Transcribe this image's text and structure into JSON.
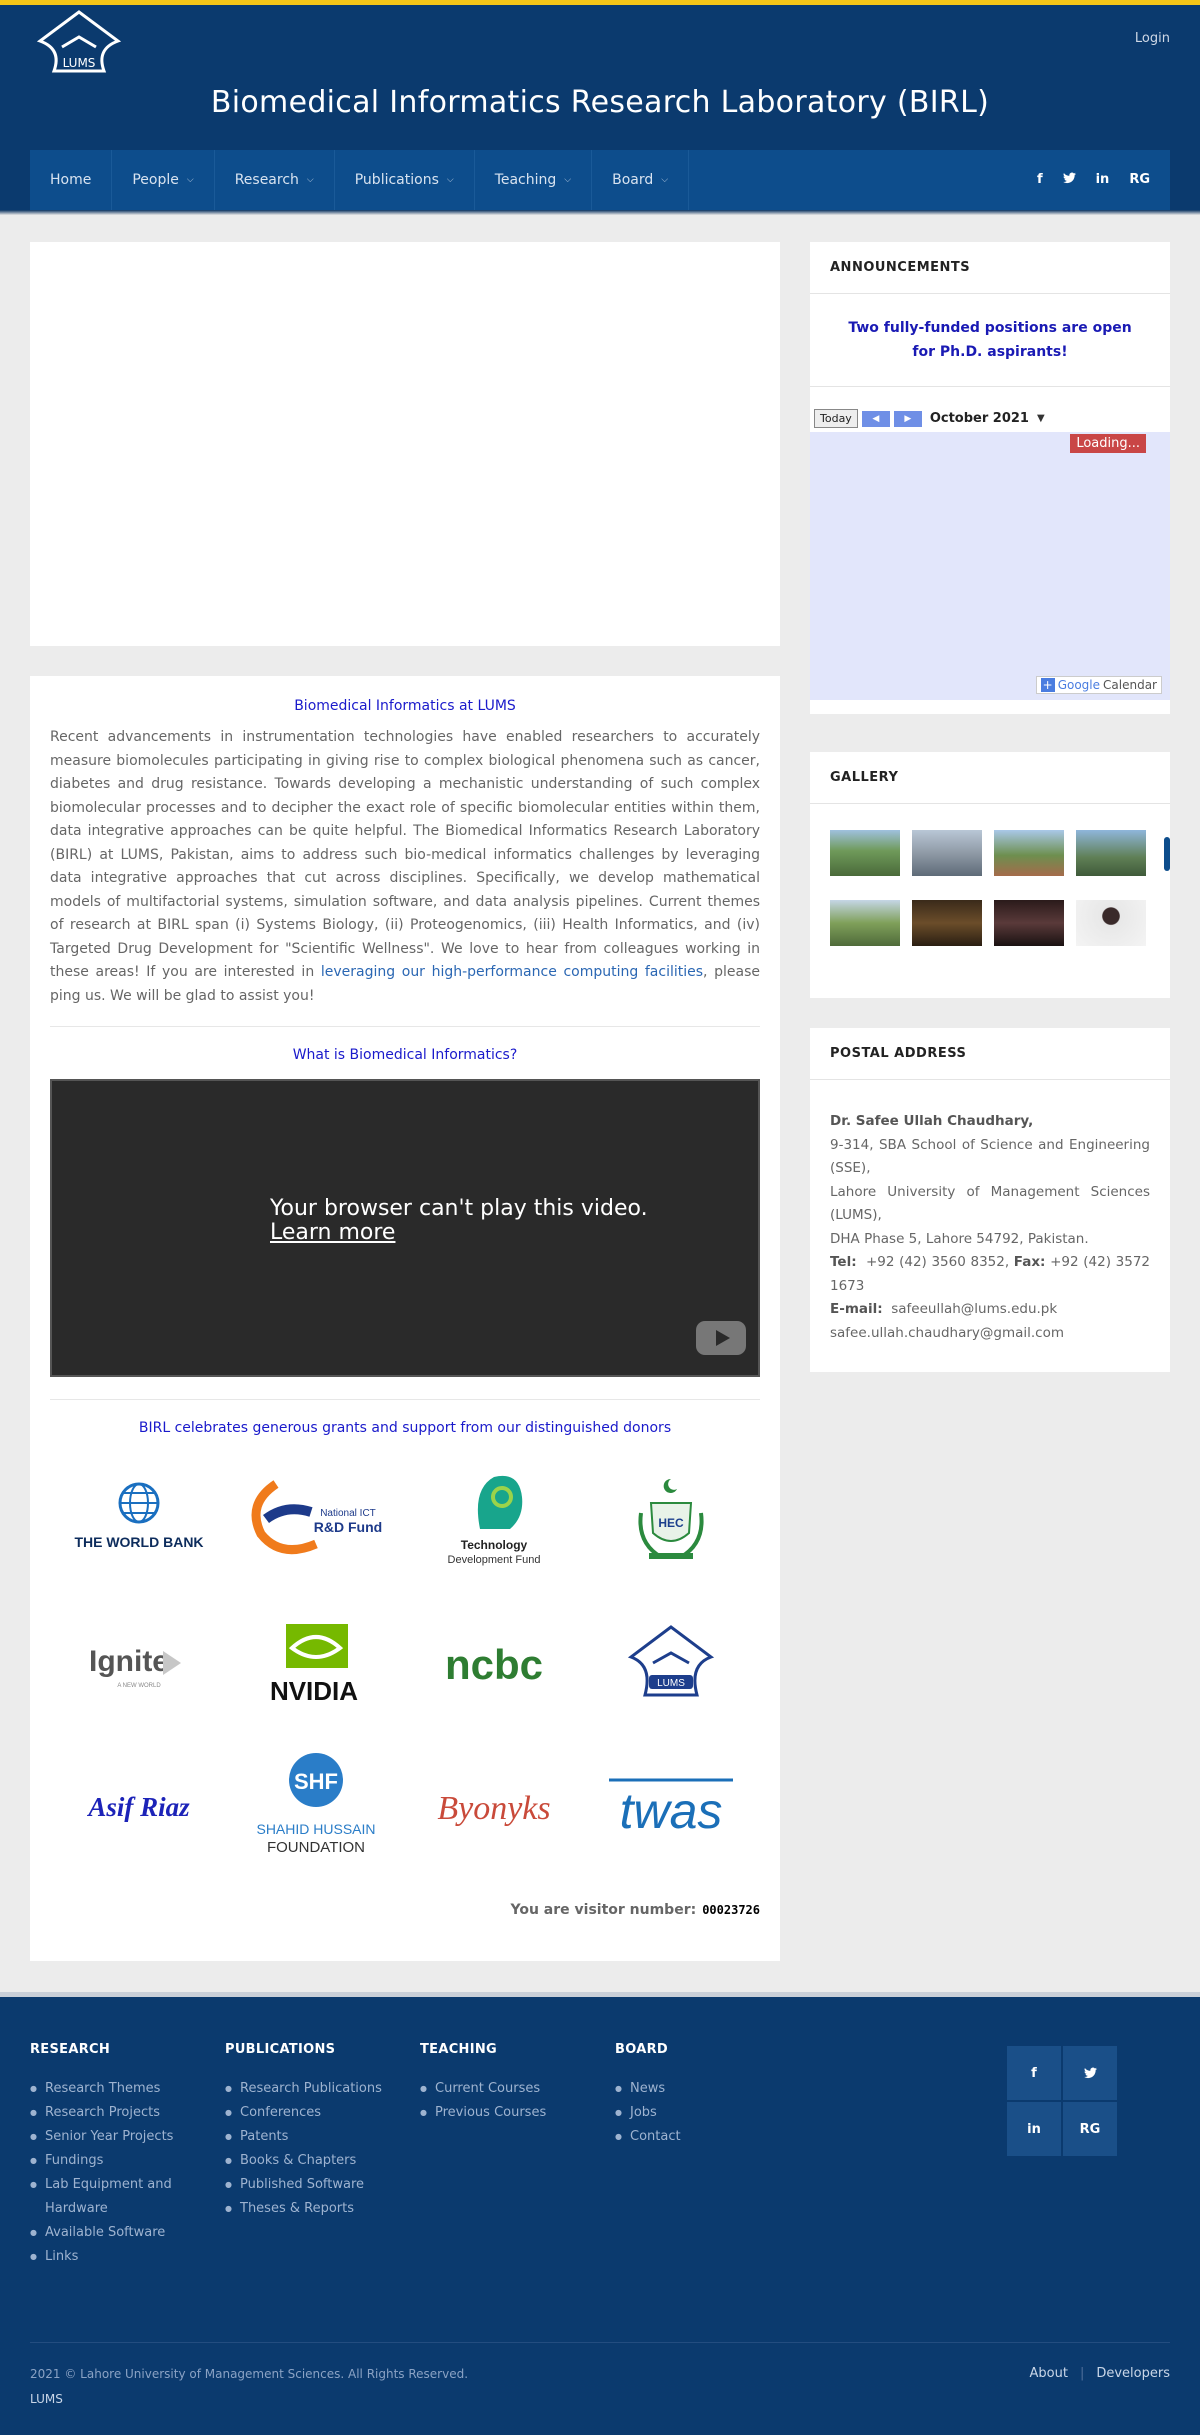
{
  "header": {
    "login": "Login",
    "title": "Biomedical Informatics Research Laboratory (BIRL)",
    "logo_text": "LUMS",
    "nav": [
      {
        "label": "Home"
      },
      {
        "label": "People"
      },
      {
        "label": "Research"
      },
      {
        "label": "Publications"
      },
      {
        "label": "Teaching"
      },
      {
        "label": "Board"
      }
    ],
    "social": [
      "f",
      "twitter",
      "in",
      "RG"
    ]
  },
  "main": {
    "intro_heading": "Biomedical Informatics at LUMS",
    "intro_text": "Recent advancements in instrumentation technologies have enabled researchers to accurately measure biomolecules participating in giving rise to complex biological phenomena such as cancer, diabetes and drug resistance. Towards developing a mechanistic understanding of such complex biomolecular processes and to decipher the exact role of specific biomolecular entities within them, data integrative approaches can be quite helpful. The Biomedical Informatics Research Laboratory (BIRL) at LUMS, Pakistan, aims to address such bio-medical informatics challenges by leveraging data integrative approaches that cut across disciplines. Specifically, we develop mathematical models of multifactorial systems, simulation software, and data analysis pipelines. Current themes of research at BIRL span (i) Systems Biology, (ii) Proteogenomics, (iii) Health Informatics, and (iv) Targeted Drug Development for \"Scientific Wellness\". We love to hear from colleagues working in these areas! If you are interested in",
    "intro_link": "leveraging our high-performance computing facilities",
    "intro_tail": ", please ping us. We will be glad to assist you!",
    "video_heading": "What is Biomedical Informatics?",
    "video_msg": "Your browser can't play this video.",
    "video_learn": "Learn more",
    "donors_heading": "BIRL celebrates generous grants and support from our distinguished donors",
    "donors": [
      {
        "name": "THE WORLD BANK"
      },
      {
        "name": "National ICT R&D Fund",
        "line1": "National ICT",
        "line2": "R&D Fund"
      },
      {
        "name": "Technology Development Fund",
        "line1": "Technology",
        "line2": "Development Fund"
      },
      {
        "name": "HEC"
      },
      {
        "name": "Ignite",
        "sub": "A NEW WORLD"
      },
      {
        "name": "NVIDIA"
      },
      {
        "name": "ncbc"
      },
      {
        "name": "LUMS"
      },
      {
        "name": "Asif Riaz"
      },
      {
        "name": "Shahid Hussain Foundation",
        "badge": "SHF",
        "line1": "SHAHID HUSSAIN",
        "line2": "FOUNDATION"
      },
      {
        "name": "Byonyks"
      },
      {
        "name": "twas"
      }
    ],
    "visitor_label": "You are visitor number:",
    "visitor_number": "00023726"
  },
  "sidebar": {
    "announcements_title": "ANNOUNCEMENTS",
    "announcement": "Two fully-funded positions are open for Ph.D. aspirants!",
    "calendar": {
      "today": "Today",
      "month": "October 2021",
      "loading": "Loading...",
      "brand": "Google",
      "brand_suffix": "Calendar"
    },
    "gallery_title": "GALLERY",
    "postal_title": "POSTAL ADDRESS",
    "postal": {
      "name": "Dr. Safee Ullah Chaudhary,",
      "line1": "9-314, SBA School of Science and Engineering (SSE),",
      "line2": "Lahore University of Management Sciences (LUMS),",
      "line3": "DHA Phase 5, Lahore 54792, Pakistan.",
      "tel_label": "Tel:",
      "tel": "+92 (42) 3560 8352,",
      "fax_label": "Fax:",
      "fax": "+92 (42) 3572 1673",
      "email_label": "E-mail:",
      "email1": "safeeullah@lums.edu.pk",
      "email2": "safee.ullah.chaudhary@gmail.com"
    }
  },
  "footer": {
    "columns": [
      {
        "title": "RESEARCH",
        "items": [
          "Research Themes",
          "Research Projects",
          "Senior Year Projects",
          "Fundings",
          "Lab Equipment and Hardware",
          "Available Software",
          "Links"
        ]
      },
      {
        "title": "PUBLICATIONS",
        "items": [
          "Research Publications",
          "Conferences",
          "Patents",
          "Books & Chapters",
          "Published Software",
          "Theses & Reports"
        ]
      },
      {
        "title": "TEACHING",
        "items": [
          "Current Courses",
          "Previous Courses"
        ]
      },
      {
        "title": "BOARD",
        "items": [
          "News",
          "Jobs",
          "Contact"
        ]
      }
    ],
    "social": [
      "f",
      "twitter",
      "in",
      "RG"
    ],
    "copyright": "2021 © Lahore University of Management Sciences. All Rights Reserved.",
    "lums": "LUMS",
    "links": [
      "About",
      "Developers"
    ]
  },
  "colors": {
    "header_bg": "#0b3a6e",
    "nav_bg": "#0d4d8c",
    "accent_bar": "#f5c518",
    "heading_blue": "#1a1acb",
    "link_blue": "#2b67b3"
  }
}
